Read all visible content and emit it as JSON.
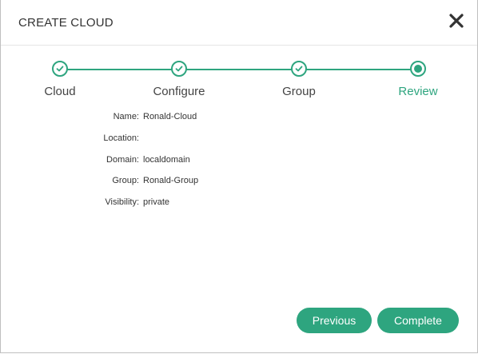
{
  "dialog": {
    "title": "CREATE CLOUD",
    "close_icon": "close-icon"
  },
  "stepper": {
    "steps": [
      {
        "label": "Cloud",
        "state": "completed"
      },
      {
        "label": "Configure",
        "state": "completed"
      },
      {
        "label": "Group",
        "state": "completed"
      },
      {
        "label": "Review",
        "state": "active"
      }
    ],
    "accent_color": "#2ea57f"
  },
  "review": {
    "fields": [
      {
        "label": "Name:",
        "value": "Ronald-Cloud"
      },
      {
        "label": "Location:",
        "value": ""
      },
      {
        "label": "Domain:",
        "value": "localdomain"
      },
      {
        "label": "Group:",
        "value": "Ronald-Group"
      },
      {
        "label": "Visibility:",
        "value": "private"
      }
    ]
  },
  "footer": {
    "previous_label": "Previous",
    "complete_label": "Complete"
  }
}
